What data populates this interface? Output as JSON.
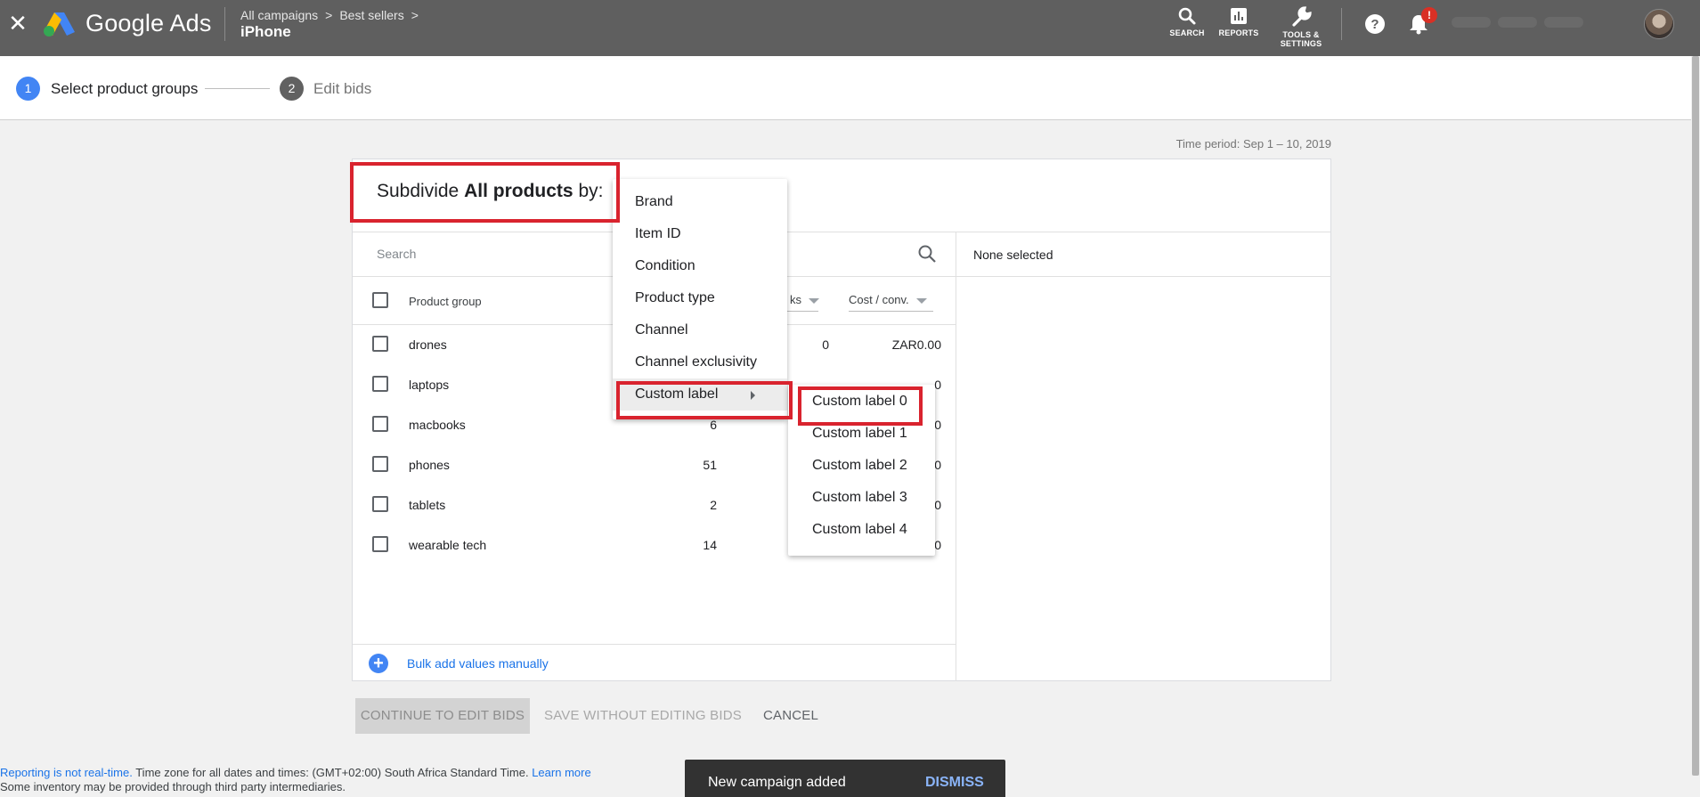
{
  "topbar": {
    "close_icon": "close-icon",
    "app_name": "Google Ads",
    "breadcrumb": [
      "All campaigns",
      "Best sellers"
    ],
    "breadcrumb_sep": ">",
    "campaign_name": "iPhone",
    "tools": [
      {
        "label": "SEARCH",
        "icon": "search-icon"
      },
      {
        "label": "REPORTS",
        "icon": "reports-icon"
      },
      {
        "label": "TOOLS &",
        "label2": "SETTINGS",
        "icon": "wrench-icon"
      }
    ],
    "notification_badge": "!"
  },
  "stepper": {
    "steps": [
      {
        "num": "1",
        "label": "Select product groups",
        "active": true
      },
      {
        "num": "2",
        "label": "Edit bids",
        "active": false
      }
    ]
  },
  "time_period": "Time period: Sep 1 – 10, 2019",
  "card": {
    "subdivide_prefix": "Subdivide",
    "subdivide_bold": "All products",
    "subdivide_suffix": "by:",
    "search_placeholder": "Search",
    "none_selected": "None selected",
    "columns": {
      "product_group": "Product group",
      "clicks": "ks",
      "cost_conv": "Cost / conv."
    },
    "rows": [
      {
        "name": "drones",
        "count": "",
        "clicks": "0",
        "cost": "ZAR0.00"
      },
      {
        "name": "laptops",
        "count": "",
        "clicks": "",
        "cost": "0"
      },
      {
        "name": "macbooks",
        "count": "6",
        "clicks": "",
        "cost": "0"
      },
      {
        "name": "phones",
        "count": "51",
        "clicks": "",
        "cost": "0"
      },
      {
        "name": "tablets",
        "count": "2",
        "clicks": "",
        "cost": "0"
      },
      {
        "name": "wearable tech",
        "count": "14",
        "clicks": "",
        "cost": "0"
      }
    ],
    "bulk_add": "Bulk add values manually"
  },
  "dimension_menu": [
    "Brand",
    "Item ID",
    "Condition",
    "Product type",
    "Channel",
    "Channel exclusivity",
    "Custom label"
  ],
  "custom_label_menu": [
    "Custom label 0",
    "Custom label 1",
    "Custom label 2",
    "Custom label 3",
    "Custom label 4"
  ],
  "buttons": {
    "continue": "CONTINUE TO EDIT BIDS",
    "save": "SAVE WITHOUT EDITING BIDS",
    "cancel": "CANCEL"
  },
  "footer": {
    "not_realtime": "Reporting is not real-time.",
    "timezone": " Time zone for all dates and times: (GMT+02:00) South Africa Standard Time. ",
    "learn_more": "Learn more",
    "line2": "Some inventory may be provided through third party intermediaries."
  },
  "toast": {
    "message": "New campaign added",
    "action": "DISMISS"
  },
  "colors": {
    "topbar": "#5f5f5f",
    "accent_blue": "#4285f4",
    "highlight_red": "#d9232e",
    "toast_bg": "#323232"
  }
}
